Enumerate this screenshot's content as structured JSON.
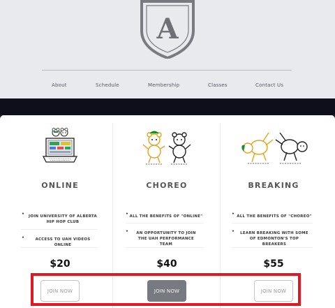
{
  "brand": {
    "logo_letter": "A"
  },
  "nav": {
    "items": [
      {
        "label": "About"
      },
      {
        "label": "Schedule"
      },
      {
        "label": "Membership"
      },
      {
        "label": "Classes"
      },
      {
        "label": "Contact Us"
      }
    ]
  },
  "plans": [
    {
      "name": "ONLINE",
      "icon": "laptop-bears-icon",
      "features": [
        "JOIN UNIVERSITY OF ALBERTA HIP HOP CLUB",
        "ACCESS TO UAH VIDEOS ONLINE"
      ],
      "price": "$20",
      "button": "JOIN NOW"
    },
    {
      "name": "CHOREO",
      "icon": "dancing-bears-icon",
      "features": [
        "ALL THE BENEFITS OF \"ONLINE\"",
        "AN OPPORTUNITY TO JOIN THE UAH PERFORMANCE TEAM"
      ],
      "price": "$40",
      "button": "JOIN NOW"
    },
    {
      "name": "BREAKING",
      "icon": "breakdancing-bears-icon",
      "features": [
        "ALL THE BENEFITS OF \"CHOREO\"",
        "LEARN BREAKING WITH SOME OF EDMONTON'S TOP BREAKERS"
      ],
      "price": "$55",
      "button": "JOIN NOW"
    }
  ],
  "colors": {
    "header_bg": "#e9eaee",
    "dark_band": "#0e0f1a",
    "highlight": "#e01a22",
    "accent_green": "#1c8a2c",
    "bear_gold": "#e7a21b"
  }
}
